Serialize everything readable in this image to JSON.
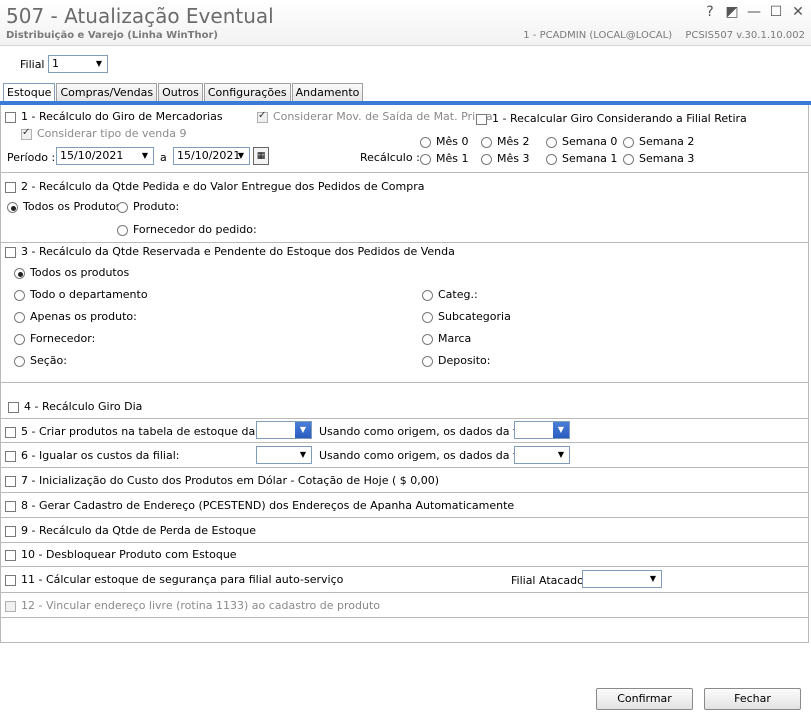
{
  "window": {
    "title": "507 - Atualização Eventual",
    "subtitle": "Distribuição e Varejo (Linha WinThor)",
    "user": "1 - PCADMIN (LOCAL@LOCAL)",
    "version": "PCSIS507  v.30.1.10.002",
    "controls": {
      "help": "?",
      "restore": "◩",
      "minimize": "—",
      "maximize": "☐",
      "close": "✕"
    }
  },
  "filial": {
    "label": "Filial",
    "value": "1"
  },
  "tabs": [
    "Estoque",
    "Compras/Vendas",
    "Outros",
    "Configurações",
    "Andamento"
  ],
  "s1": {
    "label": "1 - Recálculo do Giro de Mercadorias",
    "considerar_mov": "Considerar Mov. de Saída de Mat. Prima",
    "recalcular_giro": "1 - Recalcular Giro Considerando a Filial Retira",
    "considerar_tipo": "Considerar tipo de venda 9",
    "periodo_label": "Período :",
    "date_from": "15/10/2021",
    "a_label": "a",
    "date_to": "15/10/2021",
    "recalculo_label": "Recálculo :",
    "opts_row1": [
      "Mês 0",
      "Mês 2",
      "Semana 0",
      "Semana 2"
    ],
    "opts_row2": [
      "Mês 1",
      "Mês 3",
      "Semana 1",
      "Semana 3"
    ]
  },
  "s2": {
    "label": "2 - Recálculo da Qtde Pedida e do Valor Entregue dos Pedidos de Compra",
    "todos": "Todos os Produtos",
    "produto": "Produto:",
    "fornecedor": "Fornecedor do pedido:"
  },
  "s3": {
    "label": "3 - Recálculo da Qtde Reservada e Pendente do Estoque dos Pedidos de Venda",
    "todos": "Todos os produtos",
    "departamento": "Todo o departamento",
    "apenas": "Apenas os produto:",
    "fornecedor": "Fornecedor:",
    "secao": "Seção:",
    "categ": "Categ.:",
    "subcategoria": "Subcategoria",
    "marca": "Marca",
    "deposito": "Deposito:"
  },
  "s4": {
    "label": "4 - Recálculo Giro Dia"
  },
  "s5": {
    "label": "5 - Criar produtos na tabela de estoque da filial:",
    "origem": "Usando como origem, os dados da filial:"
  },
  "s6": {
    "label": "6 - Igualar os custos da filial:",
    "origem": "Usando como origem, os dados da filial:"
  },
  "s7": {
    "label": "7 - Inicialização do Custo dos Produtos em Dólar - Cotação de Hoje ( $ 0,00)"
  },
  "s8": {
    "label": "8 - Gerar Cadastro de Endereço (PCESTEND) dos Endereços de Apanha Automaticamente"
  },
  "s9": {
    "label": "9 - Recálculo da Qtde de Perda de Estoque"
  },
  "s10": {
    "label": "10 - Desbloquear Produto com Estoque"
  },
  "s11": {
    "label": "11 - Cálcular estoque de segurança para filial auto-serviço",
    "filial_atacado": "Filial Atacado:"
  },
  "s12": {
    "label": "12 - Vincular endereço livre (rotina 1133) ao cadastro de produto"
  },
  "buttons": {
    "confirmar": "Confirmar",
    "fechar": "Fechar"
  },
  "icons": {
    "dropdown": "chevron-down-icon",
    "calendar": "calendar-icon"
  },
  "colors": {
    "tab_accent": "#3b7ad6",
    "title_text": "#6b6b6b"
  }
}
